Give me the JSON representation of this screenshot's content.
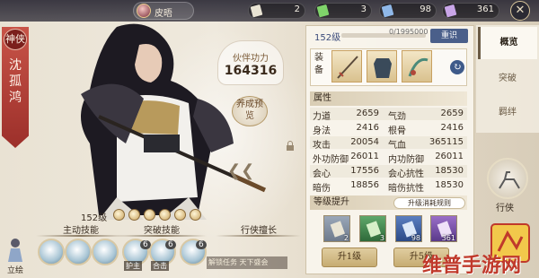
{
  "top_bar": {
    "player_name": "皮晤",
    "resources": [
      {
        "icon": "scroll-ticket-icon",
        "value": "2"
      },
      {
        "icon": "green-ticket-icon",
        "value": "3"
      },
      {
        "icon": "blue-ticket-icon",
        "value": "98"
      },
      {
        "icon": "purple-ticket-icon",
        "value": "361"
      }
    ],
    "close_glyph": "✕"
  },
  "character": {
    "rank_seal": "神侠",
    "name": "沈孤鸿"
  },
  "combat": {
    "label": "伙伴功力",
    "value": "164316",
    "preview_label": "养成预览"
  },
  "skills": {
    "level_text": "152级",
    "tabs": [
      "主动技能",
      "突破技能",
      "行侠擅长"
    ],
    "icons": [
      {
        "badge": "",
        "label": ""
      },
      {
        "badge": "",
        "label": ""
      },
      {
        "badge": "",
        "label": ""
      },
      {
        "badge": "6",
        "label": "护主"
      },
      {
        "badge": "6",
        "label": "合击"
      },
      {
        "badge": "6",
        "label": ""
      }
    ],
    "stand_label": "立绘",
    "bottom_banner": "解锁任务 天下盛会"
  },
  "panel": {
    "level": "152级",
    "exp_text": "0/1995000",
    "reset_label": "重识",
    "equip_label": "装备",
    "attr_title": "属性",
    "stats": [
      {
        "n1": "力道",
        "v1": "2659",
        "n2": "气劲",
        "v2": "2659"
      },
      {
        "n1": "身法",
        "v1": "2416",
        "n2": "根骨",
        "v2": "2416"
      },
      {
        "n1": "攻击",
        "v1": "20054",
        "n2": "气血",
        "v2": "365115"
      },
      {
        "n1": "外功防御",
        "v1": "26011",
        "n2": "内功防御",
        "v2": "26011"
      },
      {
        "n1": "会心",
        "v1": "17556",
        "n2": "会心抗性",
        "v2": "18530"
      },
      {
        "n1": "暗伤",
        "v1": "18856",
        "n2": "暗伤抗性",
        "v2": "18530"
      }
    ],
    "upgrade_title": "等级提升",
    "cost_label": "升级消耗规则",
    "materials": [
      "2",
      "3",
      "98",
      "361"
    ],
    "up1_label": "升1级",
    "up5_label": "升5级"
  },
  "nav": {
    "tabs": [
      "概览",
      "突破",
      "羁绊"
    ],
    "travel_label": "行侠"
  },
  "watermark": "维普手游网",
  "colors": {
    "accent_red": "#9c2f2a",
    "panel_blue": "#4a5f8a",
    "gold": "#c6ac72"
  }
}
